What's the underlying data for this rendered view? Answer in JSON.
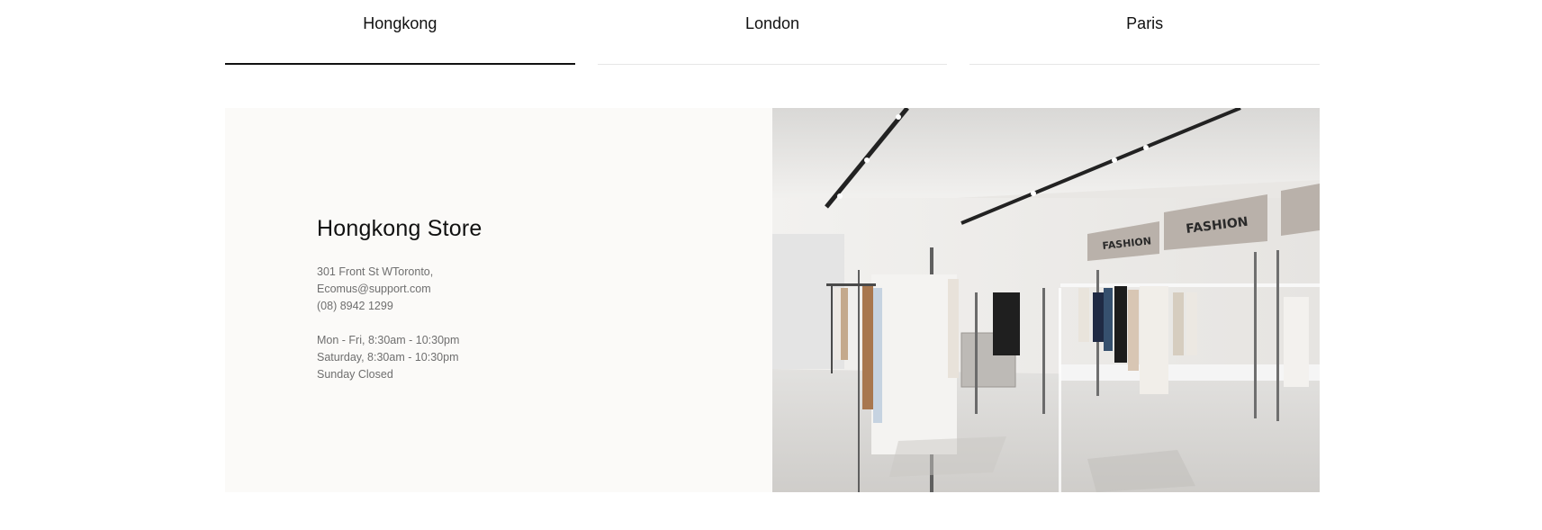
{
  "tabs": [
    {
      "label": "Hongkong",
      "active": true
    },
    {
      "label": "London",
      "active": false
    },
    {
      "label": "Paris",
      "active": false
    }
  ],
  "store": {
    "title": "Hongkong Store",
    "address": "301 Front St WToronto,",
    "email": "Ecomus@support.com",
    "phone": "(08) 8942 1299",
    "hours": [
      "Mon - Fri, 8:30am - 10:30pm",
      "Saturday, 8:30am - 10:30pm",
      "Sunday Closed"
    ],
    "image": {
      "signs": [
        "FASHION",
        "FASHION"
      ]
    }
  },
  "colors": {
    "active_underline": "#111111",
    "panel_bg": "#fbfaf8",
    "muted_text": "#6f6f6f"
  }
}
